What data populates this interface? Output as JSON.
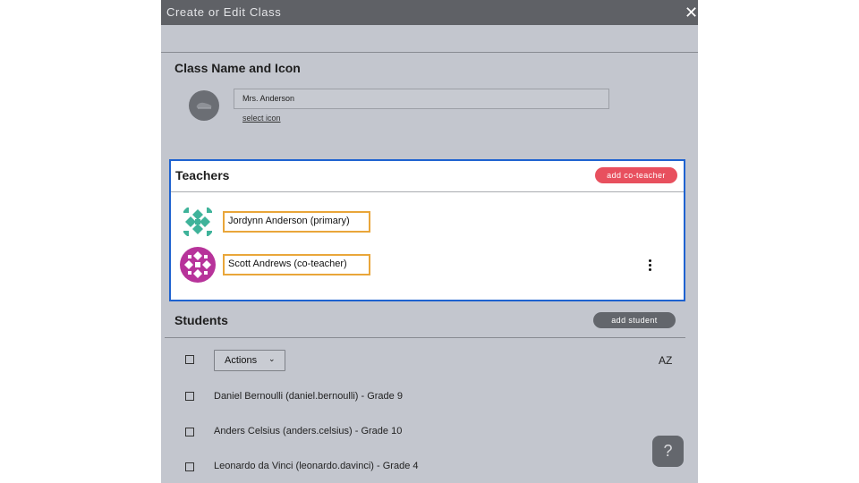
{
  "dialog": {
    "title": "Create or Edit Class",
    "close_glyph": "✕"
  },
  "class_section": {
    "heading": "Class Name and Icon",
    "icon": "shoe-icon",
    "name_value": "Mrs. Anderson",
    "select_icon_link": "select icon"
  },
  "teachers": {
    "heading": "Teachers",
    "add_button": "add co-teacher",
    "items": [
      {
        "name": "Jordynn Anderson (primary)",
        "avatar_color": "#3fb39a"
      },
      {
        "name": "Scott Andrews (co-teacher)",
        "avatar_color": "#b7339a"
      }
    ],
    "accent_color": "#1e62d0",
    "highlight_color": "#e9a63a"
  },
  "students": {
    "heading": "Students",
    "add_button": "add student",
    "actions_label": "Actions",
    "actions_caret": "⌄",
    "sort_icon": "sort-alpha-icon",
    "sort_label": "AZ",
    "items": [
      "Daniel Bernoulli (daniel.bernoulli) - Grade 9",
      "Anders Celsius (anders.celsius) - Grade 10",
      "Leonardo da Vinci (leonardo.davinci) - Grade 4"
    ]
  },
  "help": {
    "glyph": "?"
  }
}
